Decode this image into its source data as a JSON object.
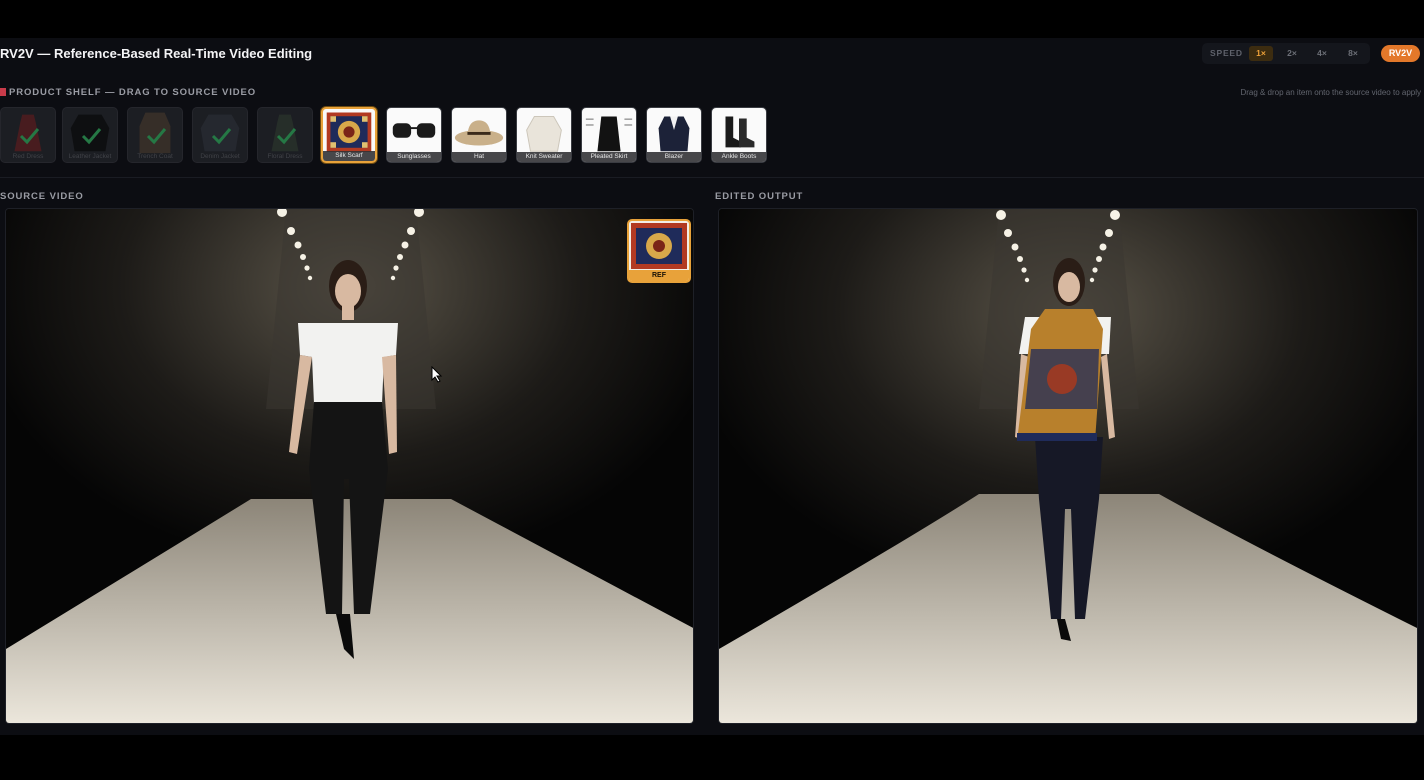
{
  "app": {
    "title": "RV2V — Reference-Based Real-Time Video Editing",
    "brand_badge": "RV2V",
    "accent_color": "#e8a23a",
    "brand_color": "#e3782a"
  },
  "speed": {
    "label": "SPEED",
    "options": [
      "1×",
      "2×",
      "4×",
      "8×"
    ],
    "selected": "1×"
  },
  "shelf": {
    "title": "PRODUCT SHELF — DRAG TO SOURCE VIDEO",
    "hint": "Drag & drop an item onto the source video to apply",
    "items": [
      {
        "label": "Red Dress",
        "state": "applied"
      },
      {
        "label": "Leather Jacket",
        "state": "applied"
      },
      {
        "label": "Trench Coat",
        "state": "applied"
      },
      {
        "label": "Denim Jacket",
        "state": "applied"
      },
      {
        "label": "Floral Dress",
        "state": "applied"
      },
      {
        "label": "Silk Scarf",
        "state": "selected"
      },
      {
        "label": "Sunglasses",
        "state": "available"
      },
      {
        "label": "Hat",
        "state": "available"
      },
      {
        "label": "Knit Sweater",
        "state": "available"
      },
      {
        "label": "Pleated Skirt",
        "state": "available"
      },
      {
        "label": "Blazer",
        "state": "available"
      },
      {
        "label": "Ankle Boots",
        "state": "available"
      }
    ]
  },
  "source": {
    "label": "SOURCE VIDEO",
    "ref_label": "REF"
  },
  "output": {
    "label": "EDITED OUTPUT"
  }
}
